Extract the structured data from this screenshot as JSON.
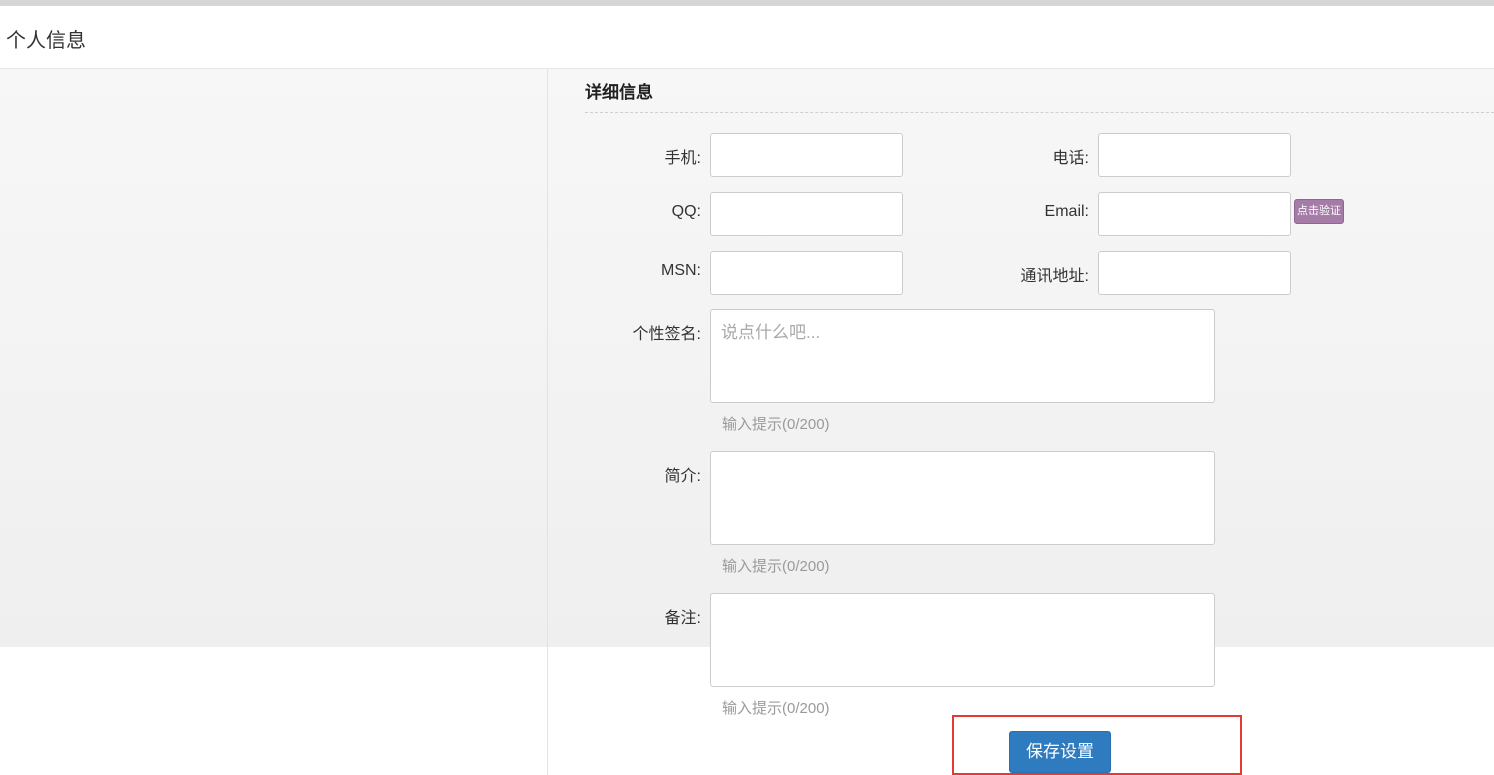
{
  "header": {
    "title": "个人信息"
  },
  "section": {
    "title": "详细信息"
  },
  "fields": {
    "mobile": {
      "label": "手机:",
      "value": ""
    },
    "phone": {
      "label": "电话:",
      "value": ""
    },
    "qq": {
      "label": "QQ:",
      "value": ""
    },
    "email": {
      "label": "Email:",
      "value": "",
      "verify_label": "点击验证"
    },
    "msn": {
      "label": "MSN:",
      "value": ""
    },
    "address": {
      "label": "通讯地址:",
      "value": ""
    },
    "signature": {
      "label": "个性签名:",
      "placeholder": "说点什么吧...",
      "hint": "输入提示(0/200)"
    },
    "intro": {
      "label": "简介:",
      "placeholder": "",
      "hint": "输入提示(0/200)"
    },
    "remark": {
      "label": "备注:",
      "placeholder": "",
      "hint": "输入提示(0/200)"
    }
  },
  "actions": {
    "save_label": "保存设置"
  },
  "colors": {
    "save_button": "#2f7bbf",
    "verify_button": "#a57ca8",
    "highlight_border": "#e53935"
  }
}
